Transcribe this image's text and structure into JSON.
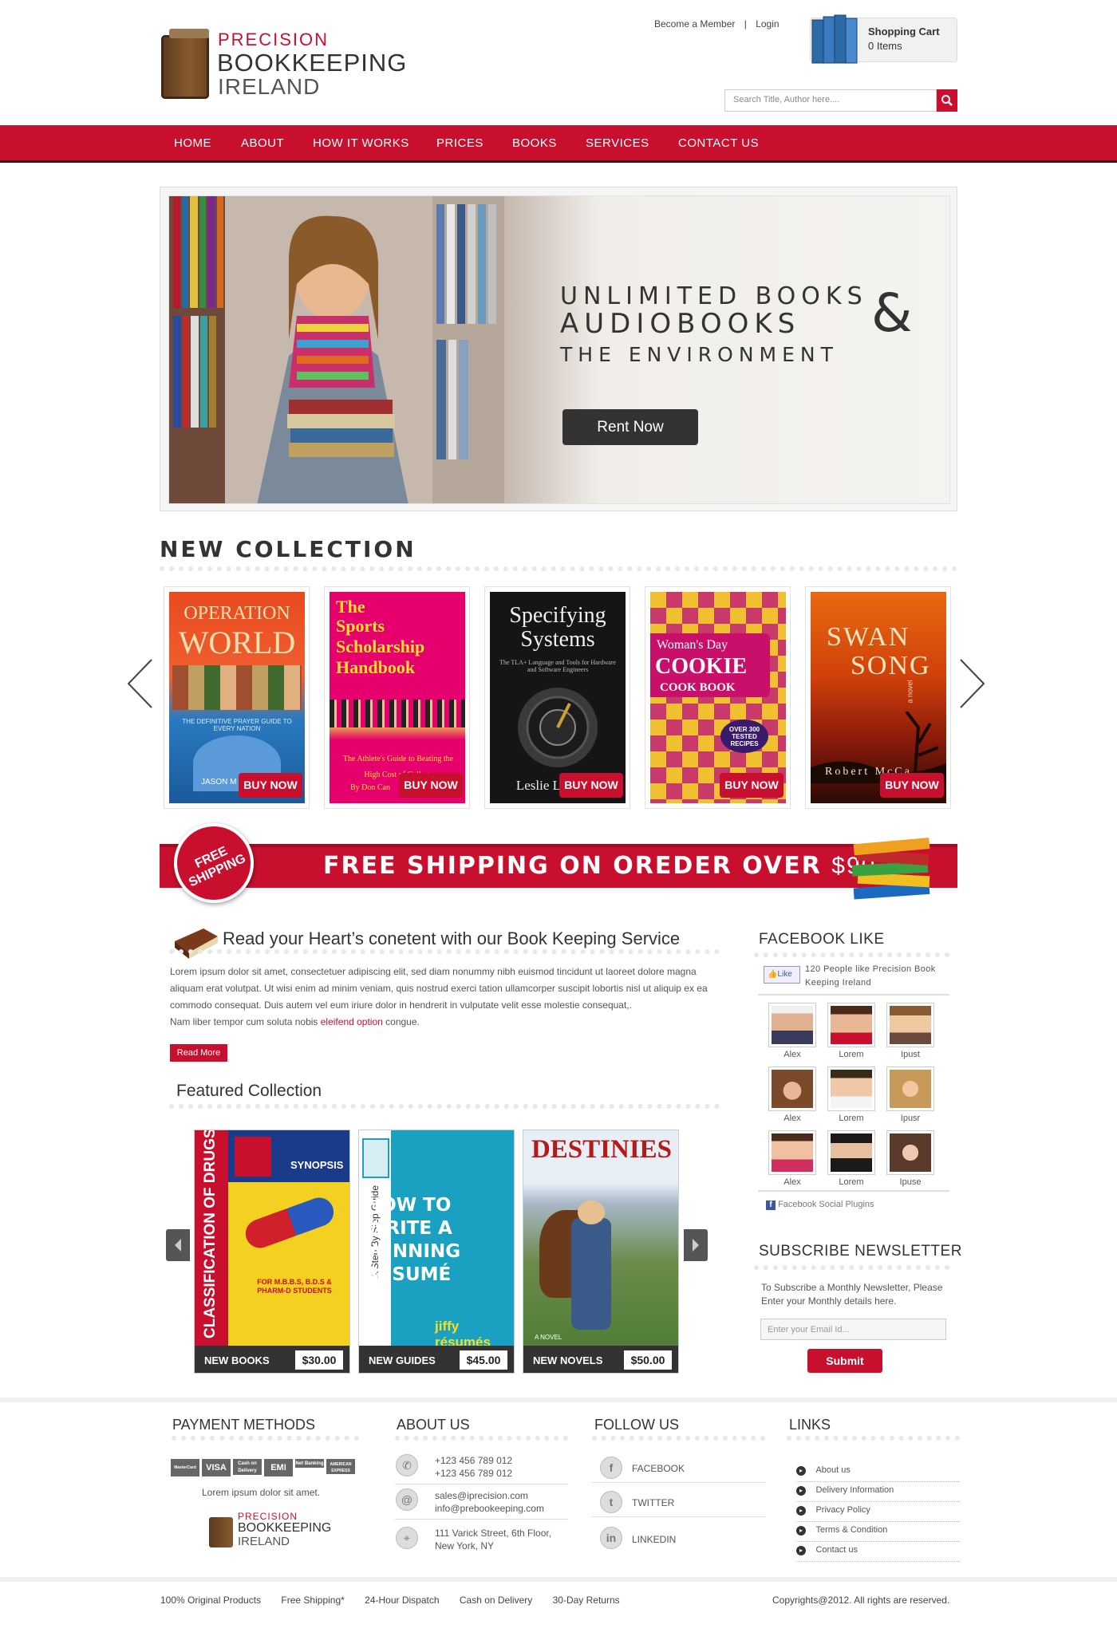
{
  "header": {
    "logo": {
      "line1": "PRECISION",
      "line2": "BOOKKEEPING",
      "line3": "IRELAND"
    },
    "become_member": "Become a Member",
    "sep": "|",
    "login": "Login",
    "cart_title": "Shopping Cart",
    "cart_items": "0 Items",
    "search_placeholder": "Search Title, Author here...."
  },
  "nav": [
    "HOME",
    "ABOUT",
    "HOW IT WORKS",
    "PRICES",
    "BOOKS",
    "SERVICES",
    "CONTACT US"
  ],
  "hero": {
    "line1": "UNLIMITED BOOKS",
    "line2": "AUDIOBOOKS",
    "amp": "&",
    "line3": "THE ENVIRONMENT",
    "button": "Rent Now"
  },
  "new_collection": {
    "title": "NEW COLLECTION",
    "buy_label": "BUY NOW",
    "books": [
      {
        "t1": "OPERATION",
        "t2": "WORLD",
        "t3": "THE DEFINITIVE PRAYER GUIDE TO EVERY NATION",
        "author": "JASON M",
        "color": "#e04a1f"
      },
      {
        "t1": "The",
        "t2": "Sports Scholarship Handbook",
        "t3": "The Athlete's Guide to Beating the High Cost of College",
        "author": "By Don Can",
        "color": "#e6006e"
      },
      {
        "t1": "Specifying",
        "t2": "Systems",
        "t3": "The TLA+ Language and Tools for Hardware and Software Engineers",
        "author": "Leslie Lamport",
        "color": "#151515"
      },
      {
        "t1": "Woman's Day",
        "t2": "COOKIE",
        "t3": "COOK BOOK",
        "author": "OVER 300 TESTED RECIPES",
        "color": "#7a1a8a"
      },
      {
        "t1": "SWAN",
        "t2": "SONG",
        "t3": "a novel",
        "author": "Robert McCa",
        "color": "#c43a0a"
      }
    ]
  },
  "shipping": {
    "badge": "FREE SHIPPING",
    "text": "FREE SHIPPING ON OREDER OVER",
    "amount": "$90"
  },
  "intro": {
    "title": "Read your Heart’s conetent with our Book Keeping Service",
    "para": "Lorem ipsum dolor sit amet, consectetuer adipiscing elit, sed diam nonummy nibh euismod tincidunt ut laoreet dolore magna aliquam erat volutpat. Ut wisi enim ad minim veniam, quis nostrud exerci tation ullamcorper suscipit lobortis nisl ut aliquip ex ea commodo consequat. Duis autem vel eum iriure dolor in hendrerit in vulputate velit esse molestie consequat,.",
    "para2_a": "Nam liber tempor cum soluta nobis ",
    "para2_link": "eleifend option",
    "para2_b": " congue.",
    "read_more": "Read More"
  },
  "featured": {
    "title": "Featured Collection",
    "items": [
      {
        "label": "NEW BOOKS",
        "price": "$30.00",
        "spine": "CLASSIFICATION OF DRUGS",
        "heading": "SYNOPSIS",
        "sub": "FOR M.B.B.S, B.D.S & PHARM-D STUDENTS"
      },
      {
        "label": "NEW GUIDES",
        "price": "$45.00",
        "spine": "A Step By Step Guide",
        "heading": "HOW TO WRITE A WINNING RÉSUMÉ",
        "sub": "jiffy résumés"
      },
      {
        "label": "NEW NOVELS",
        "price": "$50.00",
        "spine": "",
        "heading": "DESTINIES",
        "sub": "A NOVEL"
      }
    ]
  },
  "facebook": {
    "title": "FACEBOOK LIKE",
    "like": "Like",
    "count_text": "120 People like Precision Book Keeping Ireland",
    "people": [
      "Alex",
      "Lorem",
      "Ipust",
      "Alex",
      "Lorem",
      "Ipusr",
      "Alex",
      "Lorem",
      "Ipuse"
    ],
    "plugin": "Facebook Social Plugins"
  },
  "newsletter": {
    "title": "SUBSCRIBE NEWSLETTER",
    "text": "To Subscribe a Monthly Newsletter, Please Enter your Monthly details here.",
    "placeholder": "Enter your Email Id...",
    "button": "Submit"
  },
  "footer": {
    "payment": {
      "title": "PAYMENT METHODS",
      "cards": [
        "MasterCard",
        "VISA",
        "Cash on Delivery",
        "EMI",
        "Net Banking",
        "AMERICAN EXPRESS"
      ],
      "text": "Lorem ipsum dolor sit amet."
    },
    "about": {
      "title": "ABOUT US",
      "phone1": "+123 456 789 012",
      "phone2": "+123 456 789 012",
      "email1": "sales@iprecision.com",
      "email2": "info@prebookeeping.com",
      "addr1": "111 Varick Street, 6th Floor,",
      "addr2": "New York, NY"
    },
    "follow": {
      "title": "FOLLOW US",
      "items": [
        "FACEBOOK",
        "TWITTER",
        "LINKEDIN"
      ]
    },
    "links": {
      "title": "LINKS",
      "items": [
        "About us",
        "Delivery Information",
        "Privacy Policy",
        "Terms & Condition",
        "Contact us"
      ]
    }
  },
  "bottom": {
    "items": [
      "100% Original Products",
      "Free Shipping*",
      "24-Hour Dispatch",
      "Cash on Delivery",
      "30-Day Returns"
    ],
    "copyright": "Copyrights@2012. All rights are reserved."
  }
}
